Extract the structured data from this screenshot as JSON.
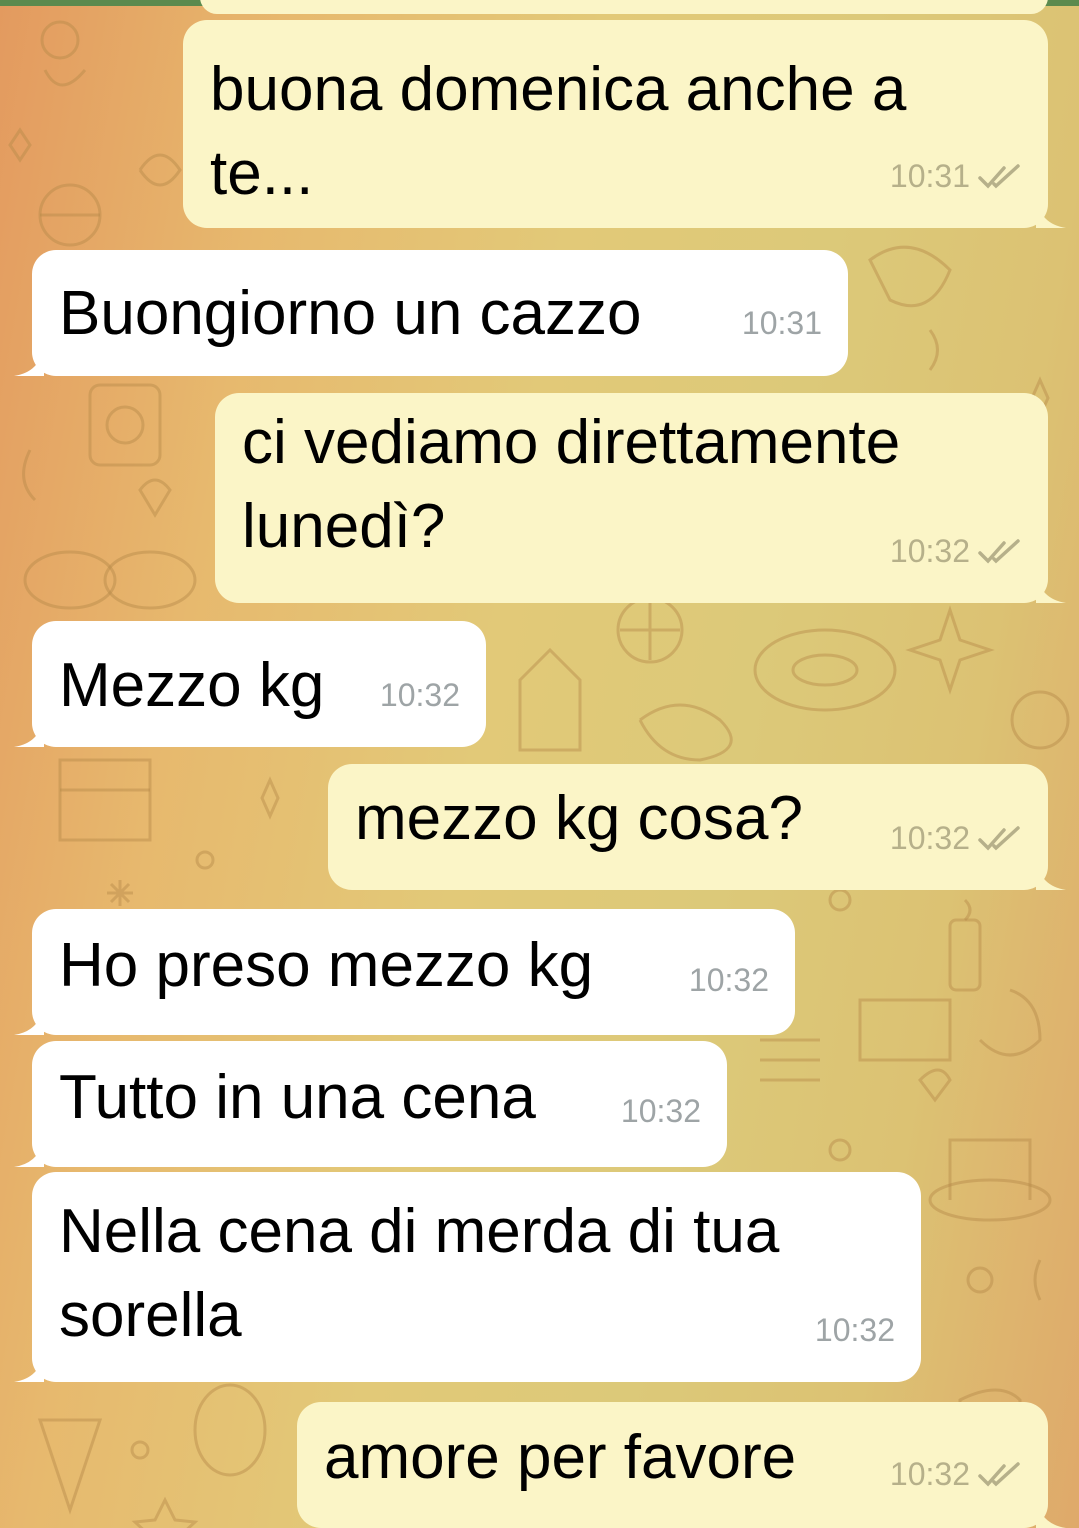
{
  "colors": {
    "outgoing_bubble": "#fbf5c7",
    "incoming_bubble": "#ffffff",
    "timestamp_incoming": "#9ea4a6",
    "timestamp_outgoing": "#b6b08a",
    "read_ticks": "#b6b08a",
    "top_bar_accent": "#5b8a4e"
  },
  "messages": [
    {
      "direction": "outgoing",
      "text": "buona domenica anche a te...",
      "time": "10:31",
      "status": "read",
      "status_icon": "double-check-icon"
    },
    {
      "direction": "incoming",
      "text": "Buongiorno un cazzo",
      "time": "10:31"
    },
    {
      "direction": "outgoing",
      "text": "ci vediamo direttamente lunedì?",
      "time": "10:32",
      "status": "read",
      "status_icon": "double-check-icon"
    },
    {
      "direction": "incoming",
      "text": "Mezzo kg",
      "time": "10:32"
    },
    {
      "direction": "outgoing",
      "text": "mezzo kg cosa?",
      "time": "10:32",
      "status": "read",
      "status_icon": "double-check-icon"
    },
    {
      "direction": "incoming",
      "text": "Ho preso mezzo kg",
      "time": "10:32"
    },
    {
      "direction": "incoming",
      "text": "Tutto in una cena",
      "time": "10:32"
    },
    {
      "direction": "incoming",
      "text": "Nella cena di merda di tua sorella",
      "time": "10:32"
    },
    {
      "direction": "outgoing",
      "text": "amore per favore",
      "time": "10:32",
      "status": "read",
      "status_icon": "double-check-icon"
    }
  ]
}
